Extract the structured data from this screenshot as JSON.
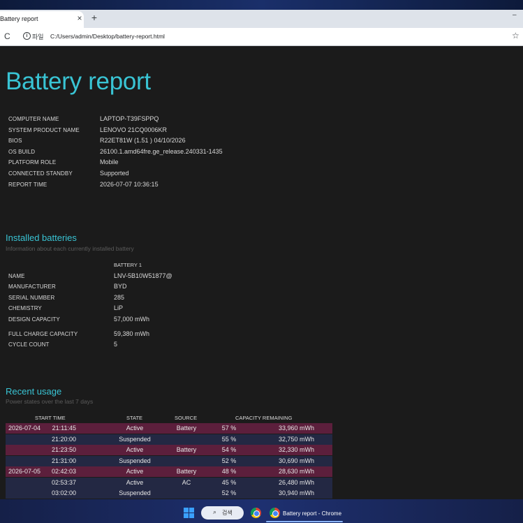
{
  "browser": {
    "tab_title": "Battery report",
    "tab_close": "×",
    "new_tab": "+",
    "minimize": "–",
    "reload": "C",
    "info": "i",
    "file_chip": "파일",
    "url": "C:/Users/admin/Desktop/battery-report.html",
    "bookmark": "☆"
  },
  "report": {
    "title": "Battery report",
    "system": [
      {
        "label": "COMPUTER NAME",
        "value": "LAPTOP-T39FSPPQ"
      },
      {
        "label": "SYSTEM PRODUCT NAME",
        "value": "LENOVO 21CQ0006KR"
      },
      {
        "label": "BIOS",
        "value": "R22ET81W (1.51 ) 04/10/2026"
      },
      {
        "label": "OS BUILD",
        "value": "26100.1.amd64fre.ge_release.240331-1435"
      },
      {
        "label": "PLATFORM ROLE",
        "value": "Mobile"
      },
      {
        "label": "CONNECTED STANDBY",
        "value": "Supported"
      },
      {
        "label": "REPORT TIME",
        "value": "2026-07-07  10:36:15"
      }
    ],
    "installed": {
      "heading": "Installed batteries",
      "subheading": "Information about each currently installed battery",
      "battery_header": "BATTERY 1",
      "rows": [
        {
          "label": "NAME",
          "value": "LNV-5B10W51877@"
        },
        {
          "label": "MANUFACTURER",
          "value": "BYD"
        },
        {
          "label": "SERIAL NUMBER",
          "value": "285"
        },
        {
          "label": "CHEMISTRY",
          "value": "LiP"
        },
        {
          "label": "DESIGN CAPACITY",
          "value": "57,000 mWh"
        },
        {
          "label": "FULL CHARGE CAPACITY",
          "value": "59,380 mWh"
        },
        {
          "label": "CYCLE COUNT",
          "value": "5"
        }
      ]
    },
    "recent": {
      "heading": "Recent usage",
      "subheading": "Power states over the last 7 days",
      "columns": [
        "START TIME",
        "STATE",
        "SOURCE",
        "CAPACITY REMAINING"
      ],
      "rows": [
        {
          "date": "2026-07-04",
          "time": "21:11:45",
          "state": "Active",
          "source": "Battery",
          "percent": "57 %",
          "mwh": "33,960 mWh"
        },
        {
          "date": "",
          "time": "21:20:00",
          "state": "Suspended",
          "source": "",
          "percent": "55 %",
          "mwh": "32,750 mWh"
        },
        {
          "date": "",
          "time": "21:23:50",
          "state": "Active",
          "source": "Battery",
          "percent": "54 %",
          "mwh": "32,330 mWh"
        },
        {
          "date": "",
          "time": "21:31:00",
          "state": "Suspended",
          "source": "",
          "percent": "52 %",
          "mwh": "30,690 mWh"
        },
        {
          "date": "2026-07-05",
          "time": "02:42:03",
          "state": "Active",
          "source": "Battery",
          "percent": "48 %",
          "mwh": "28,630 mWh"
        },
        {
          "date": "",
          "time": "02:53:37",
          "state": "Active",
          "source": "AC",
          "percent": "45 %",
          "mwh": "26,480 mWh"
        },
        {
          "date": "",
          "time": "03:02:00",
          "state": "Suspended",
          "source": "",
          "percent": "52 %",
          "mwh": "30,940 mWh"
        }
      ]
    }
  },
  "taskbar": {
    "search_text": "검색",
    "search_glyph": "⌕",
    "chrome_window_label": "Battery report - Chrome"
  },
  "colors": {
    "accent": "#39c4d4",
    "active_row": "#5c1f3c",
    "suspended_row": "#232843",
    "page_bg": "#1b1b1b"
  }
}
